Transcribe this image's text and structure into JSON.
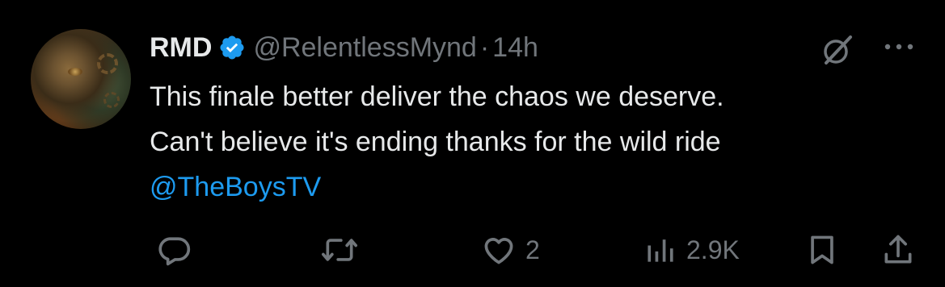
{
  "tweet": {
    "display_name": "RMD",
    "handle": "@RelentlessMynd",
    "separator": "·",
    "time": "14h",
    "text_line1": "This finale better deliver the chaos we deserve.",
    "text_line2": "Can't believe it's ending thanks for the wild ride",
    "mention": "@TheBoysTV"
  },
  "actions": {
    "reply_count": "",
    "retweet_count": "",
    "like_count": "2",
    "views_count": "2.9K"
  },
  "colors": {
    "background": "#000000",
    "text": "#e7e9ea",
    "muted": "#71767b",
    "accent": "#1d9bf0"
  },
  "icons": [
    "verified-badge-icon",
    "grok-icon",
    "more-icon",
    "reply-icon",
    "retweet-icon",
    "like-icon",
    "views-icon",
    "bookmark-icon",
    "share-icon"
  ]
}
